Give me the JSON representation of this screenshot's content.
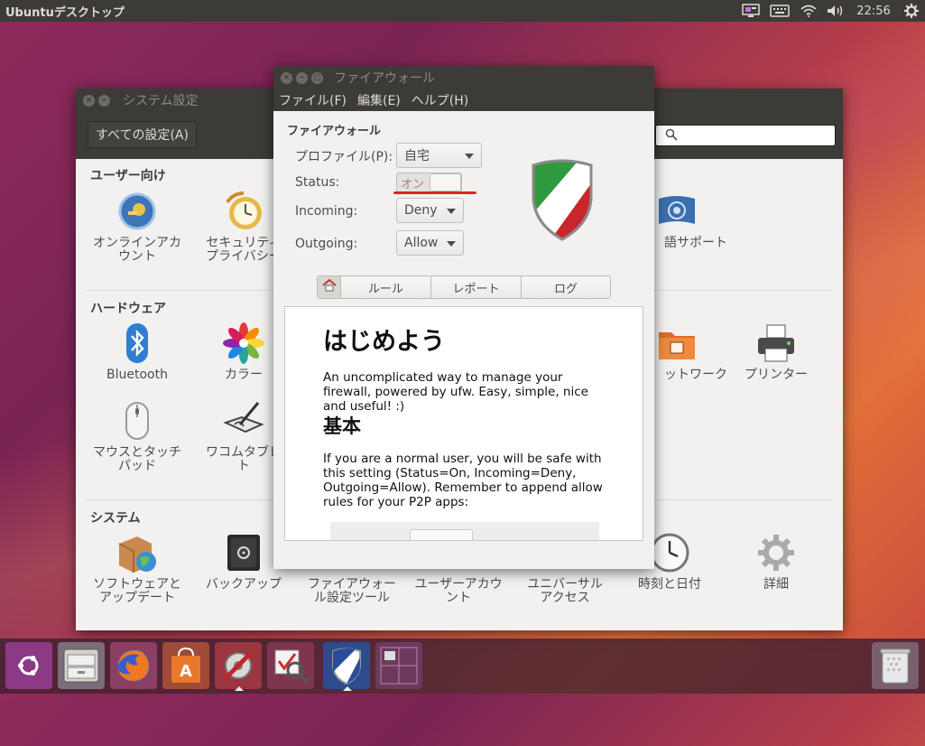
{
  "top_panel": {
    "title": "Ubuntuデスクトップ",
    "clock": "22:56",
    "indicators": [
      "screen-icon",
      "keyboard-icon",
      "wifi-icon",
      "volume-icon",
      "gear-icon"
    ]
  },
  "settings_window": {
    "title": "システム設定",
    "all_settings_button": "すべての設定(A)",
    "search_placeholder": "",
    "sections": {
      "personal": "ユーザー向け",
      "hardware": "ハードウェア",
      "system": "システム"
    },
    "items": {
      "online_accounts": [
        "オンラインアカ",
        "ウント"
      ],
      "security_privacy": [
        "セキュリティ",
        "プライバシー"
      ],
      "language_support": "語サポート",
      "bluetooth": "Bluetooth",
      "color": "カラー",
      "network": "ットワーク",
      "printers": "プリンター",
      "mouse_touchpad": [
        "マウスとタッチ",
        "パッド"
      ],
      "wacom_tablet": [
        "ワコムタブレ",
        "ト"
      ],
      "software_updates": [
        "ソフトウェアと",
        "アップデート"
      ],
      "backups": "バックアップ",
      "firewall_tool": [
        "ファイアウォー",
        "ル設定ツール"
      ],
      "user_accounts": [
        "ユーザーアカウ",
        "ント"
      ],
      "universal_access": [
        "ユニバーサル",
        "アクセス"
      ],
      "time_date": "時刻と日付",
      "details": "詳細"
    }
  },
  "firewall_window": {
    "title": "ファイアウォール",
    "menu": {
      "file": "ファイル(F)",
      "edit": "編集(E)",
      "help": "ヘルプ(H)"
    },
    "heading": "ファイアウォール",
    "labels": {
      "profile": "プロファイル(P):",
      "status": "Status:",
      "incoming": "Incoming:",
      "outgoing": "Outgoing:"
    },
    "profile_value": "自宅",
    "status_value": "オン",
    "incoming_value": "Deny",
    "outgoing_value": "Allow",
    "tabs": {
      "home": "home-icon",
      "rules": "ルール",
      "report": "レポート",
      "log": "ログ"
    },
    "content": {
      "title": "はじめよう",
      "intro": "An uncomplicated way to manage your firewall, powered by ufw. Easy, simple, nice and useful! :)",
      "basics_title": "基本",
      "basics_text": "If you are a normal user, you will be safe with this setting (Status=On, Incoming=Deny, Outgoing=Allow). Remember to append allow rules for your P2P apps:"
    },
    "shield_colors": [
      "#2f9a3f",
      "#ffffff",
      "#c8262a"
    ]
  },
  "launcher": {
    "items": [
      "ubuntu-logo-icon",
      "files-icon",
      "firefox-icon",
      "software-center-icon",
      "system-settings-icon",
      "firewall-search-icon",
      "gufw-shield-icon",
      "workspace-switcher-icon",
      "trash-icon"
    ]
  }
}
